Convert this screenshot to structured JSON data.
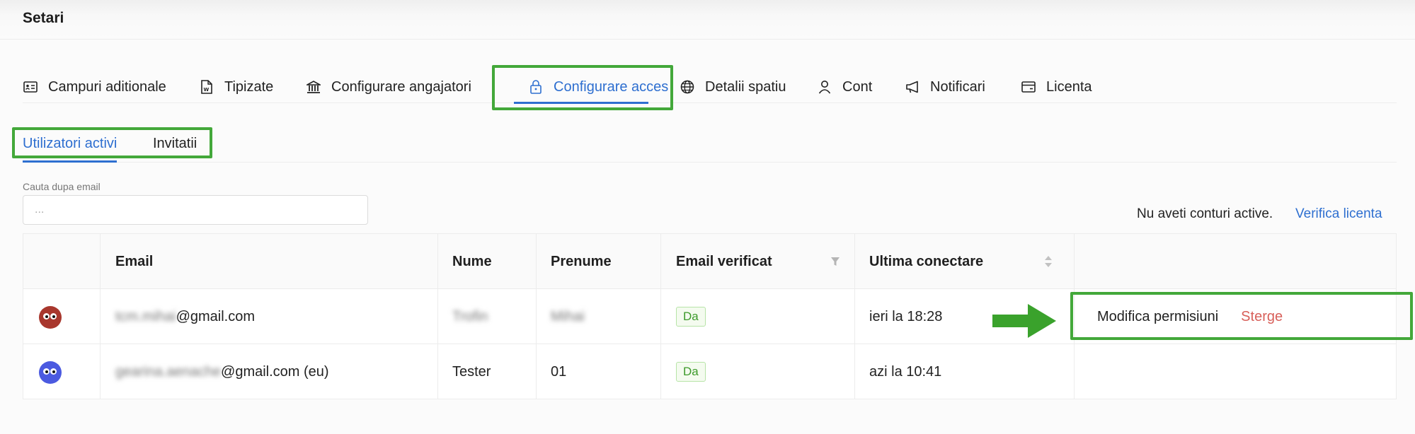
{
  "page": {
    "title": "Setari"
  },
  "tabs": [
    {
      "label": "Campuri aditionale",
      "icon": "id-card-icon"
    },
    {
      "label": "Tipizate",
      "icon": "word-file-icon"
    },
    {
      "label": "Configurare angajatori",
      "icon": "bank-icon"
    },
    {
      "label": "Configurare acces",
      "icon": "lock-icon",
      "active": true
    },
    {
      "label": "Detalii spatiu",
      "icon": "globe-icon"
    },
    {
      "label": "Cont",
      "icon": "user-icon"
    },
    {
      "label": "Notificari",
      "icon": "megaphone-icon"
    },
    {
      "label": "Licenta",
      "icon": "wallet-icon"
    }
  ],
  "subtabs": [
    {
      "label": "Utilizatori activi",
      "active": true
    },
    {
      "label": "Invitatii"
    }
  ],
  "search": {
    "label": "Cauta dupa email",
    "placeholder": "..."
  },
  "license": {
    "message": "Nu aveti conturi active.",
    "link": "Verifica licenta"
  },
  "table": {
    "columns": [
      "Email",
      "Nume",
      "Prenume",
      "Email verificat",
      "Ultima conectare"
    ],
    "rows": [
      {
        "avatar_color": "#a8372d",
        "email_hidden": "tcm.mihai",
        "email_suffix": "@gmail.com",
        "nume": "Trofin",
        "prenume": "Mihai",
        "verified": "Da",
        "last_login": "ieri la 18:28",
        "actions": {
          "edit": "Modifica permisiuni",
          "delete": "Sterge"
        }
      },
      {
        "avatar_color": "#4b5ae0",
        "email_hidden": "gearina.aenache",
        "email_suffix": "@gmail.com (eu)",
        "nume": "Tester",
        "prenume": "01",
        "verified": "Da",
        "last_login": "azi la 10:41"
      }
    ]
  },
  "colors": {
    "accent": "#2e6fd0",
    "highlight": "#43a83a",
    "danger": "#d8605a"
  }
}
